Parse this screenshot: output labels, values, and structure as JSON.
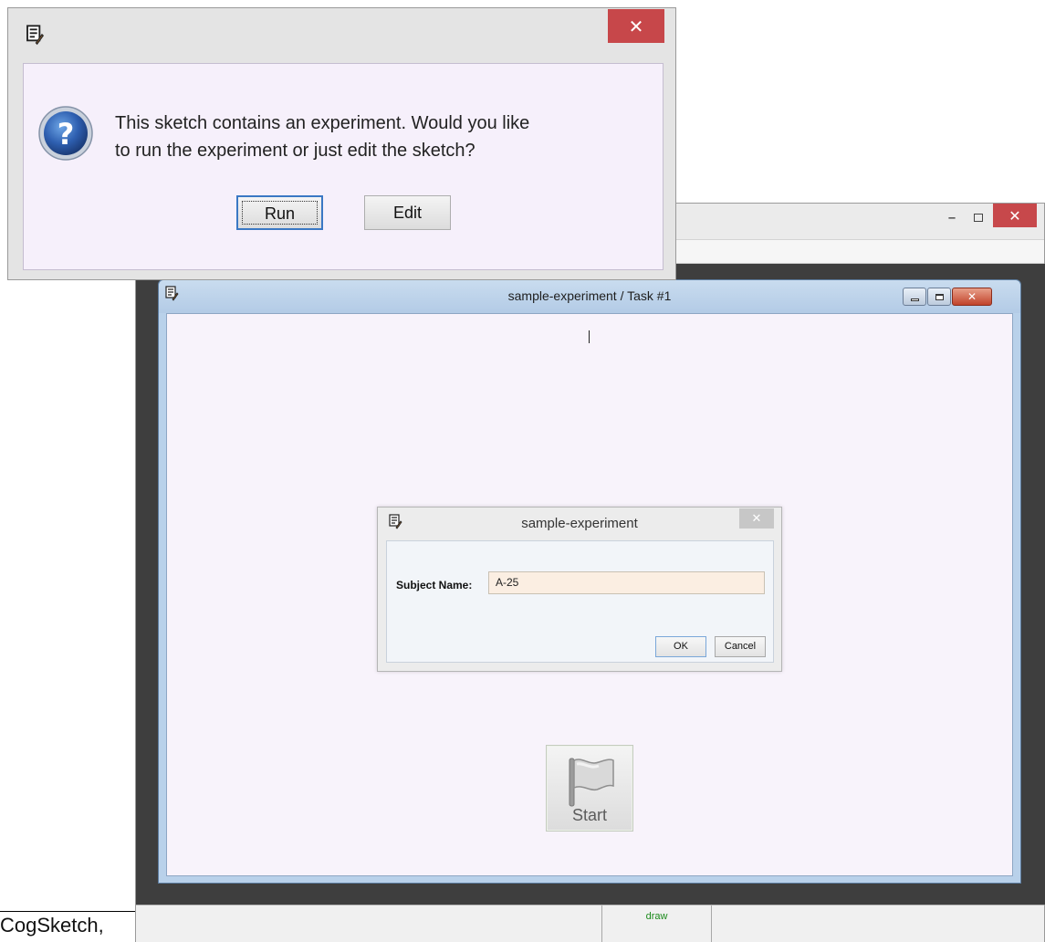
{
  "question_dialog": {
    "message_line1": "This sketch contains an experiment.  Would you like",
    "message_line2": "to run the experiment or just edit the sketch?",
    "run_label": "Run",
    "edit_label": "Edit",
    "close_glyph": "✕",
    "icon": "question-icon"
  },
  "main_window": {
    "minimize_glyph": "–",
    "close_glyph": "✕",
    "status_mode": "draw"
  },
  "task_window": {
    "title": "sample-experiment / Task #1",
    "close_glyph": "✕",
    "start_label": "Start",
    "start_icon": "flag-icon"
  },
  "subject_dialog": {
    "title": "sample-experiment",
    "close_glyph": "✕",
    "field_label": "Subject Name:",
    "field_value": "A-25",
    "ok_label": "OK",
    "cancel_label": "Cancel"
  },
  "caption": "CogSketch,",
  "colors": {
    "close_red": "#c7474a",
    "canvas_dark": "#3e3e3e",
    "dialog_bg": "#f6f0fb",
    "field_bg": "#fbeee2",
    "status_green": "#1a8a1a"
  }
}
